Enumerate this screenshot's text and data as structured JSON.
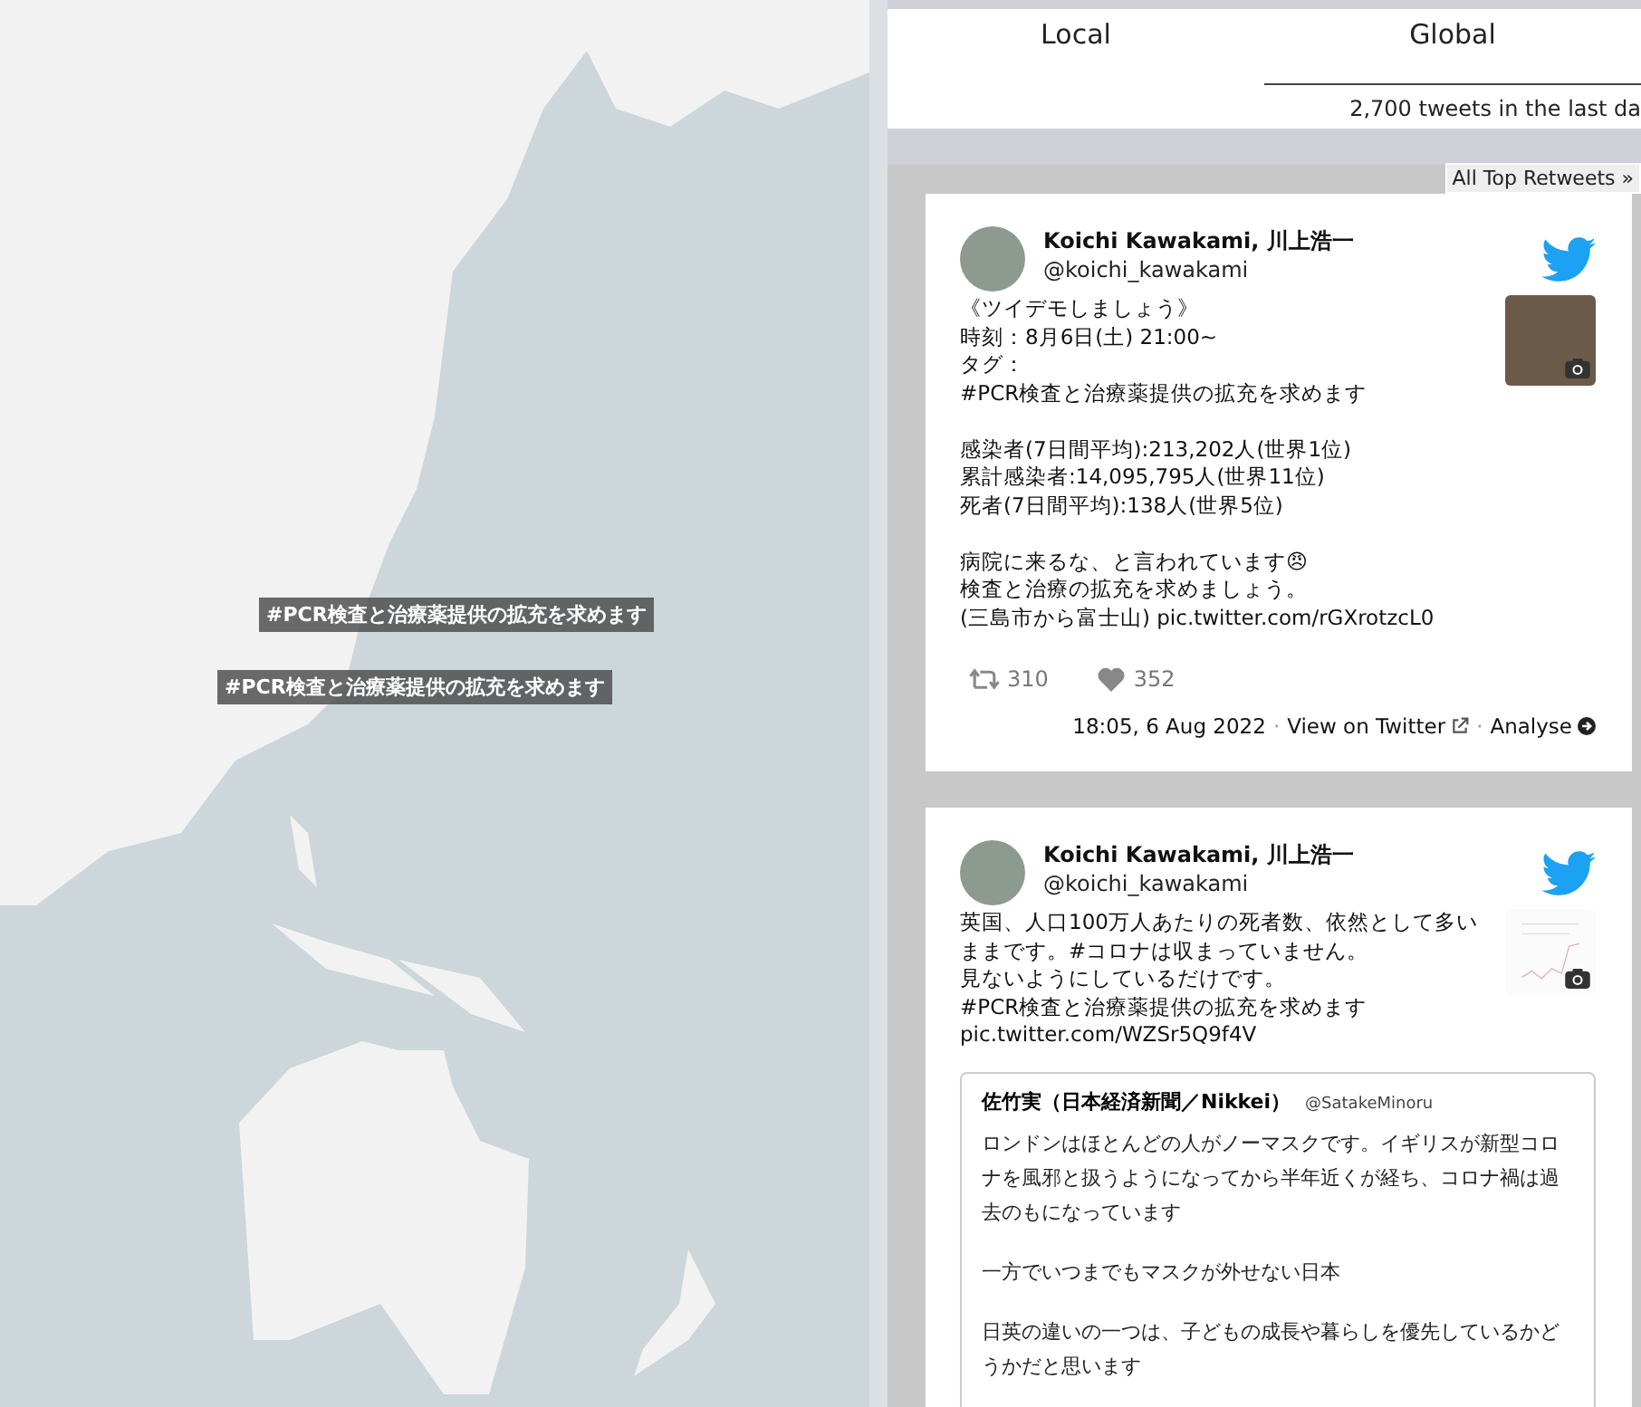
{
  "map": {
    "labels": [
      {
        "text": "#PCR検査と治療薬提供の拡充を求めます"
      },
      {
        "text": "#PCR検査と治療薬提供の拡充を求めます"
      }
    ]
  },
  "tabs": [
    {
      "label": "Local",
      "selected": false
    },
    {
      "label": "Global",
      "selected": true
    }
  ],
  "summary": "2,700 tweets in the last da",
  "all_button": "All Top Retweets »",
  "tweets": [
    {
      "name": "Koichi Kawakami, 川上浩一",
      "handle": "@koichi_kawakami",
      "paragraphs": [
        [
          "《ツイデモしましょう》",
          "時刻：8月6日(土) 21:00~",
          "タグ：",
          "#PCR検査と治療薬提供の拡充を求めます"
        ],
        [
          "感染者(7日間平均):213,202人(世界1位)",
          "累計感染者:14,095,795人(世界11位)",
          "死者(7日間平均):138人(世界5位)"
        ],
        [
          "病院に来るな、と言われています😠",
          "検査と治療の拡充を求めましょう。",
          "(三島市から富士山) pic.twitter.com/rGXrotzcL0"
        ]
      ],
      "thumbnail": {
        "kind": "photo"
      },
      "retweets": "310",
      "likes": "352",
      "time": "18:05, 6 Aug 2022",
      "sep1": "·",
      "view": "View on Twitter",
      "sep2": "·",
      "analyse": "Analyse"
    },
    {
      "name": "Koichi Kawakami, 川上浩一",
      "handle": "@koichi_kawakami",
      "paragraphs": [
        [
          "英国、人口100万人あたりの死者数、依然として多いままです。#コロナは収まっていません。",
          "見ないようにしているだけです。",
          "#PCR検査と治療薬提供の拡充を求めます",
          "pic.twitter.com/WZSr5Q9f4V"
        ]
      ],
      "thumbnail": {
        "kind": "chart"
      },
      "quote": {
        "name": "佐竹実（日本経済新聞／Nikkei）",
        "handle": "@SatakeMinoru",
        "paragraphs": [
          "ロンドンはほとんどの人がノーマスクです。イギリスが新型コロナを風邪と扱うようになってから半年近くが経ち、コロナ禍は過去のもになっています",
          "一方でいつまでもマスクが外せない日本",
          "日英の違いの一つは、子どもの成長や暮らしを優先しているかどうかだと思います"
        ]
      }
    }
  ]
}
